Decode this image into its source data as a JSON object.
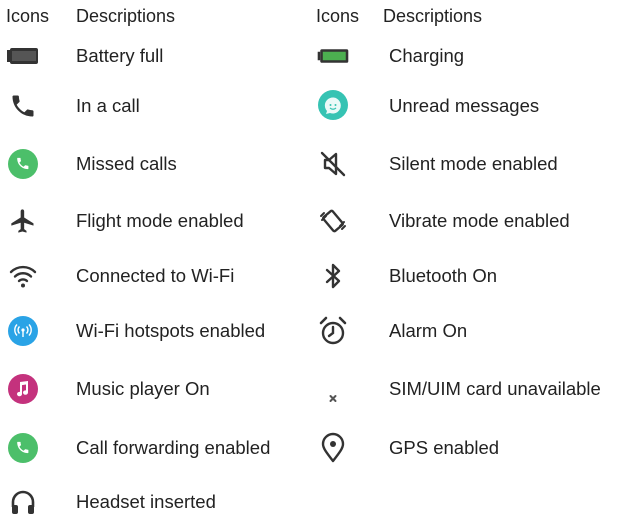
{
  "headers": {
    "left_icons": "Icons",
    "left_desc": "Descriptions",
    "right_icons": "Icons",
    "right_desc": "Descriptions"
  },
  "left_items": [
    {
      "icon": "battery-full-icon",
      "label": "Battery full"
    },
    {
      "icon": "phone-icon",
      "label": "In a call"
    },
    {
      "icon": "missed-call-icon",
      "label": "Missed calls"
    },
    {
      "icon": "airplane-icon",
      "label": "Flight mode enabled"
    },
    {
      "icon": "wifi-icon",
      "label": "Connected to Wi-Fi"
    },
    {
      "icon": "hotspot-icon",
      "label": "Wi-Fi hotspots enabled"
    },
    {
      "icon": "music-note-icon",
      "label": "Music player On"
    },
    {
      "icon": "call-forward-icon",
      "label": "Call forwarding enabled"
    },
    {
      "icon": "headset-icon",
      "label": "Headset inserted"
    }
  ],
  "right_items": [
    {
      "icon": "battery-charging-icon",
      "label": "Charging"
    },
    {
      "icon": "message-icon",
      "label": "Unread messages"
    },
    {
      "icon": "speaker-mute-icon",
      "label": "Silent mode enabled"
    },
    {
      "icon": "vibrate-icon",
      "label": "Vibrate mode enabled"
    },
    {
      "icon": "bluetooth-icon",
      "label": "Bluetooth On"
    },
    {
      "icon": "alarm-clock-icon",
      "label": "Alarm On"
    },
    {
      "icon": "sim-unavailable-icon",
      "label": "SIM/UIM card unavailable"
    },
    {
      "icon": "location-pin-icon",
      "label": "GPS enabled"
    }
  ],
  "colors": {
    "green": "#4cbf6a",
    "battery_green": "#4caf50",
    "hotspot_blue": "#2aa3e6",
    "music_magenta": "#c4327d",
    "message_teal": "#36c3b3",
    "icon_dark": "#333333"
  }
}
